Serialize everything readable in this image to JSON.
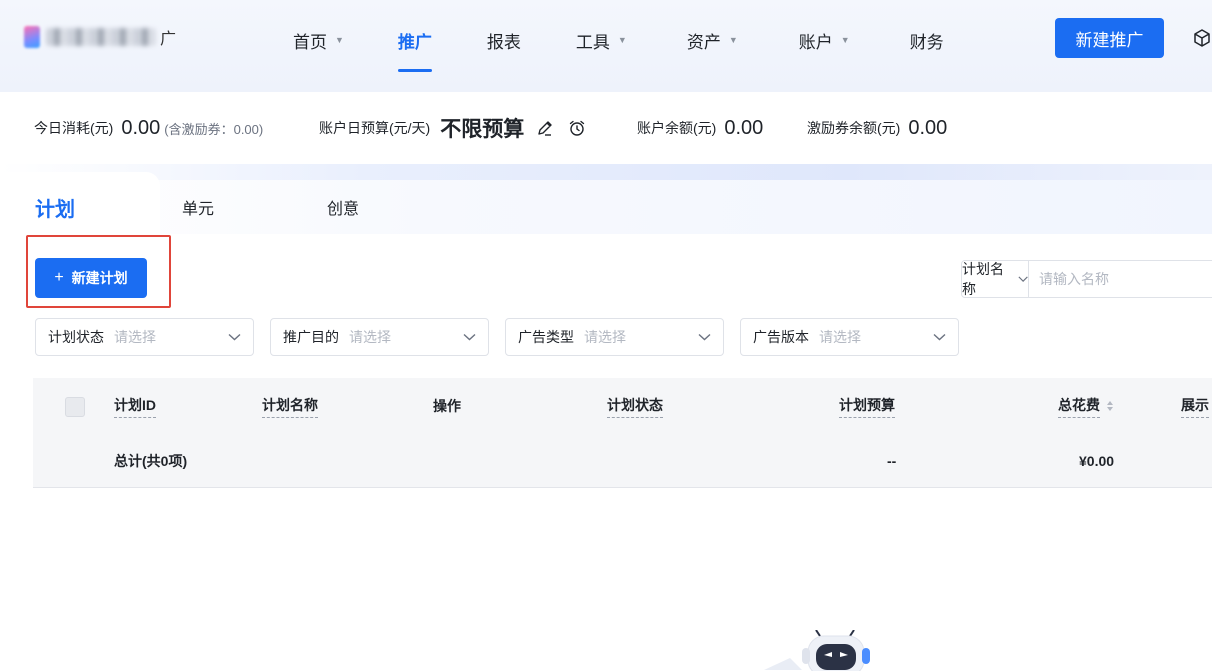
{
  "header": {
    "logo_text": "广",
    "nav": [
      {
        "label": "首页",
        "has_caret": true,
        "active": false
      },
      {
        "label": "推广",
        "has_caret": false,
        "active": true
      },
      {
        "label": "报表",
        "has_caret": false,
        "active": false
      },
      {
        "label": "工具",
        "has_caret": true,
        "active": false
      },
      {
        "label": "资产",
        "has_caret": true,
        "active": false
      },
      {
        "label": "账户",
        "has_caret": true,
        "active": false
      },
      {
        "label": "财务",
        "has_caret": false,
        "active": false
      }
    ],
    "new_promo_button": "新建推广",
    "accent_color": "#1b6df2"
  },
  "stats": {
    "today_spend_label": "今日消耗(元)",
    "today_spend_value": "0.00",
    "today_spend_note": "(含激励券：0.00)",
    "daily_budget_label": "账户日预算(元/天)",
    "daily_budget_value": "不限预算",
    "balance_label": "账户余额(元)",
    "balance_value": "0.00",
    "voucher_label": "激励券余额(元)",
    "voucher_value": "0.00"
  },
  "tabs": [
    "计划",
    "单元",
    "创意"
  ],
  "actions": {
    "new_plan_button": "新建计划",
    "search_field_select": "计划名称",
    "search_placeholder": "请输入名称"
  },
  "filters": [
    {
      "label": "计划状态",
      "placeholder": "请选择"
    },
    {
      "label": "推广目的",
      "placeholder": "请选择"
    },
    {
      "label": "广告类型",
      "placeholder": "请选择"
    },
    {
      "label": "广告版本",
      "placeholder": "请选择"
    }
  ],
  "table": {
    "columns": [
      "计划ID",
      "计划名称",
      "操作",
      "计划状态",
      "计划预算",
      "总花费",
      "展示"
    ],
    "total_row": {
      "label": "总计(共0项)",
      "budget": "--",
      "total_spend": "¥0.00"
    }
  }
}
